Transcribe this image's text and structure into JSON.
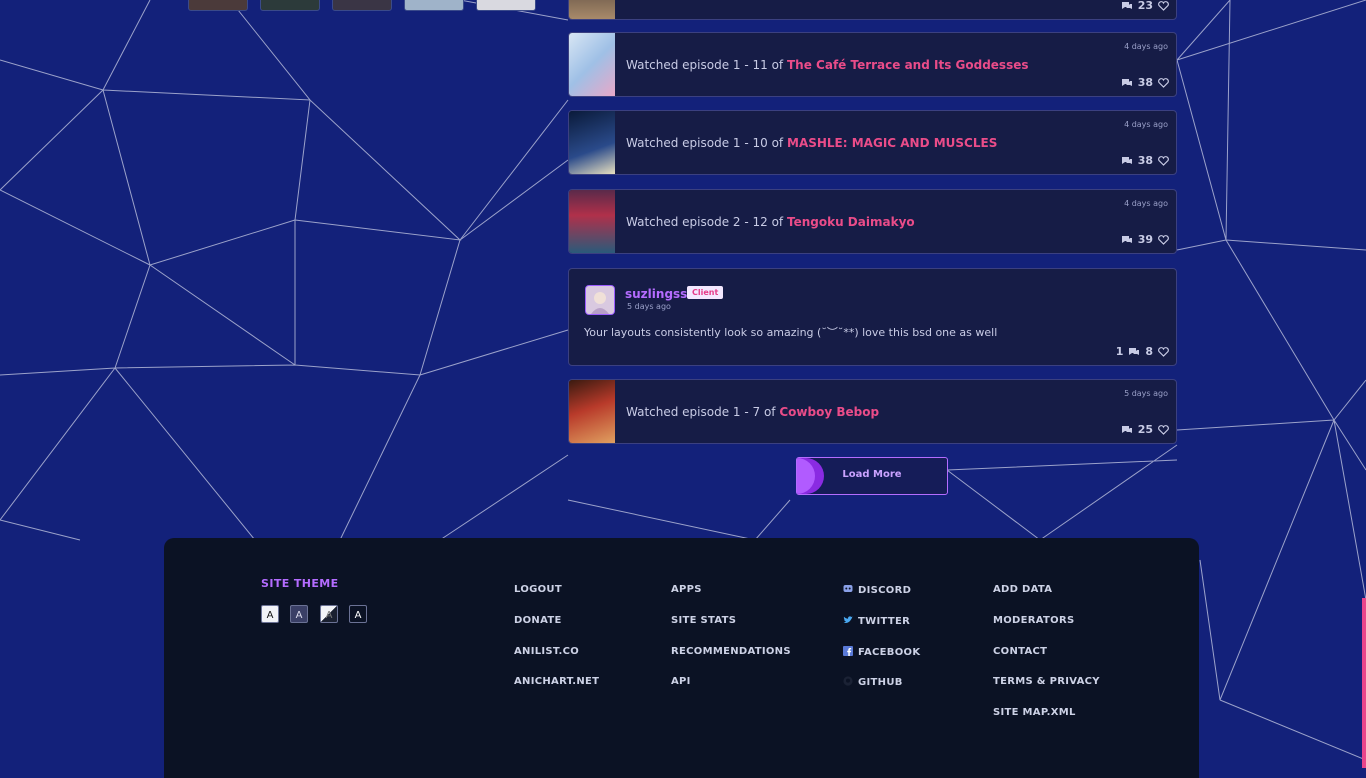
{
  "feed": {
    "activities": [
      {
        "prefix": "Watched episode 1 - 11 of",
        "title": "The Café Terrace and Its Goddesses",
        "time": "4 days ago",
        "likes": "38"
      },
      {
        "prefix": "Watched episode 1 - 10 of",
        "title": "MASHLE: MAGIC AND MUSCLES",
        "time": "4 days ago",
        "likes": "38"
      },
      {
        "prefix": "Watched episode 2 - 12 of",
        "title": "Tengoku Daimakyo",
        "time": "4 days ago",
        "likes": "39"
      },
      {
        "prefix": "Watched episode 1 - 7 of",
        "title": "Cowboy Bebop",
        "time": "5 days ago",
        "likes": "25"
      }
    ],
    "partial_top_likes": "23",
    "text_activity": {
      "username": "suzlingss",
      "badge": "Client",
      "time": "5 days ago",
      "message": "Your layouts consistently look so amazing (˘︶˘**) love this bsd one as well",
      "replies": "1",
      "likes": "8"
    },
    "load_more_label": "Load More"
  },
  "footer": {
    "site_theme_label": "SITE THEME",
    "theme_swatches": [
      "A",
      "A",
      "A",
      "A"
    ],
    "col1": [
      "LOGOUT",
      "DONATE",
      "ANILIST.CO",
      "ANICHART.NET"
    ],
    "col2": [
      "APPS",
      "SITE STATS",
      "RECOMMENDATIONS",
      "API"
    ],
    "col3": [
      "DISCORD",
      "TWITTER",
      "FACEBOOK",
      "GITHUB"
    ],
    "col4": [
      "ADD DATA",
      "MODERATORS",
      "CONTACT",
      "TERMS & PRIVACY",
      "SITE MAP.XML"
    ]
  },
  "colors": {
    "background": "#13217a",
    "accent_pink": "#ea4c89",
    "accent_purple": "#b46cff",
    "footer_bg": "#0b1224"
  },
  "icons": [
    "chat-icon",
    "heart-icon",
    "discord-icon",
    "twitter-icon",
    "facebook-icon",
    "github-icon"
  ]
}
